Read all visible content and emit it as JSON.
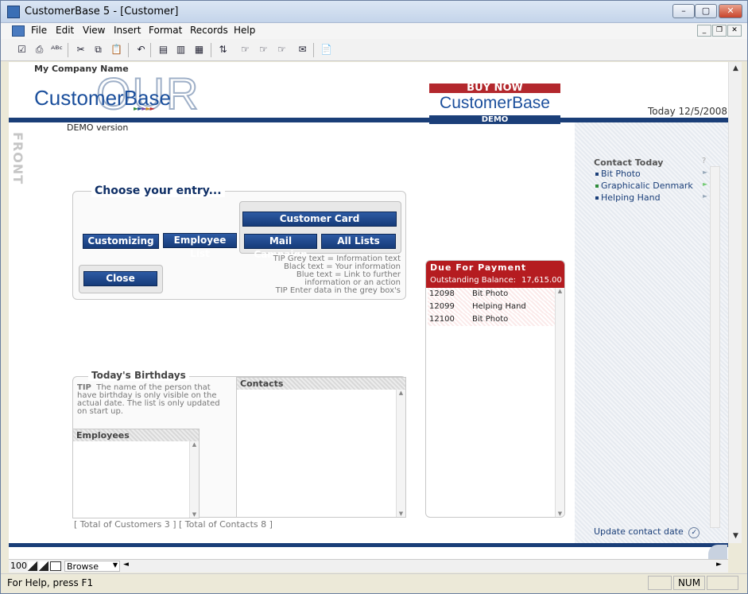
{
  "window": {
    "title": "CustomerBase 5 - [Customer]",
    "minimize": "–",
    "maximize": "▢",
    "close": "✕"
  },
  "menu": [
    "File",
    "Edit",
    "View",
    "Insert",
    "Format",
    "Records",
    "Help"
  ],
  "mdi": {
    "minimize": "_",
    "restore": "❐",
    "close": "✕"
  },
  "toolbar_icons": [
    "check-icon",
    "print-icon",
    "spellcheck-icon",
    "cut-icon",
    "copy-icon",
    "paste-icon",
    "undo-icon",
    "new-record-icon",
    "duplicate-record-icon",
    "delete-record-icon",
    "sort-icon",
    "find-icon",
    "find-next-icon",
    "find-previous-icon",
    "mail-icon",
    "script-icon"
  ],
  "toolbar_glyphs": [
    "☑",
    "⎙",
    "ᴬᴮᶜ",
    "✂",
    "⧉",
    "📋",
    "↶",
    "▤",
    "▥",
    "▦",
    "⇅",
    "☞",
    "☞",
    "☞",
    "✉",
    "📄"
  ],
  "header": {
    "company_name": "My Company Name",
    "logo_our": "OUR",
    "logo_text": "CustomerBase",
    "demo_version": "DEMO version",
    "buy_now": "BUY NOW",
    "buy_logo": "CustomerBase",
    "buy_demo": "DEMO",
    "today": "Today 12/5/2008",
    "front": "FRONT"
  },
  "entry": {
    "title": "Choose your entry...",
    "customer_card": "Customer Card",
    "customizing": "Customizing",
    "employee_list": "Employee List",
    "mail_campaign": "Mail Campaign",
    "all_lists": "All Lists",
    "close": "Close",
    "tips": [
      "TIP    Grey text = Information text",
      "Black text = Your information",
      "Blue text = Link to further",
      "information or an action",
      "TIP    Enter data in the grey box's"
    ]
  },
  "birthdays": {
    "title": "Today's Birthdays",
    "tip_label": "TIP",
    "tip_text": "The name of the person that have birthday is only visible on the actual date. The list is only updated on start up.",
    "employees_header": "Employees",
    "contacts_header": "Contacts",
    "totals": "[ Total of Customers 3 ] [ Total of Contacts 8 ]"
  },
  "due": {
    "title": "Due For Payment",
    "balance_label": "Outstanding Balance:",
    "balance_value": "17,615.00",
    "rows": [
      {
        "id": "12098",
        "name": "Bit Photo"
      },
      {
        "id": "12099",
        "name": "Helping Hand"
      },
      {
        "id": "12100",
        "name": "Bit Photo"
      }
    ]
  },
  "contact_today": {
    "title": "Contact Today",
    "help": "?",
    "items": [
      {
        "name": "Bit Photo",
        "color": "#1b3f79"
      },
      {
        "name": "Graphicalic Denmark",
        "color": "#2e8b3a"
      },
      {
        "name": "Helping Hand",
        "color": "#1b3f79"
      }
    ],
    "update": "Update contact date"
  },
  "bottom": {
    "zoom": "100",
    "mode": "Browse",
    "status_help": "For Help, press F1",
    "num": "NUM"
  }
}
